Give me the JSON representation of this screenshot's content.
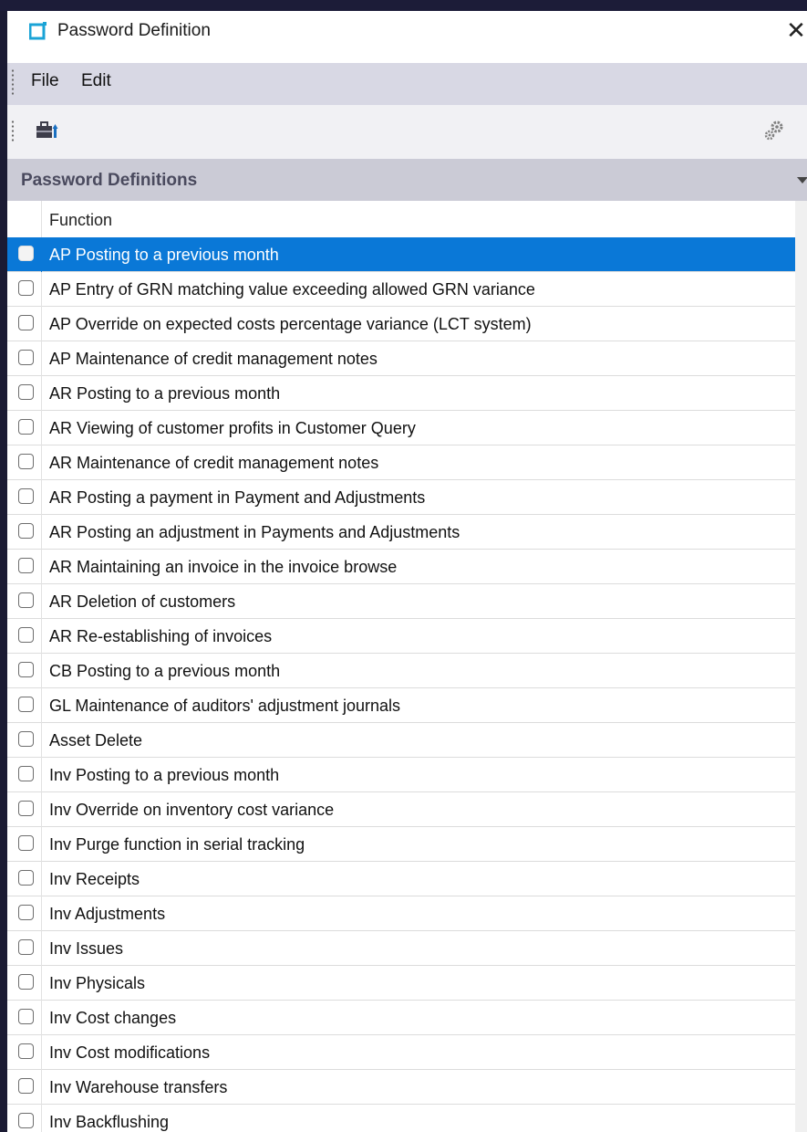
{
  "window": {
    "title": "Password Definition",
    "close_glyph": "✕"
  },
  "menu": {
    "items": [
      "File",
      "Edit"
    ]
  },
  "toolbar": {
    "icons": [
      "toolbox-icon",
      "gear-icon"
    ]
  },
  "section": {
    "title": "Password Definitions"
  },
  "grid": {
    "column_header": "Function",
    "selected_index": 0,
    "rows": [
      "AP Posting to a previous month",
      "AP Entry of GRN matching value exceeding allowed GRN variance",
      "AP Override on expected costs percentage variance (LCT system)",
      "AP Maintenance of credit management notes",
      "AR Posting to a previous month",
      "AR Viewing of customer profits in Customer Query",
      "AR Maintenance of credit management notes",
      "AR Posting a payment in Payment and Adjustments",
      "AR Posting an adjustment in Payments and Adjustments",
      "AR Maintaining an invoice in the invoice browse",
      "AR Deletion of customers",
      "AR Re-establishing of invoices",
      "CB Posting to a previous month",
      "GL Maintenance of auditors' adjustment journals",
      "Asset Delete",
      "Inv Posting to a previous month",
      "Inv Override on inventory cost variance",
      "Inv Purge function in serial tracking",
      "Inv Receipts",
      "Inv Adjustments",
      "Inv Issues",
      "Inv Physicals",
      "Inv Cost changes",
      "Inv Cost modifications",
      "Inv Warehouse transfers",
      "Inv Backflushing"
    ]
  },
  "colors": {
    "selection": "#0a78d7",
    "menubar": "#d8d8e4",
    "section_header": "#cbcbd6",
    "app_icon": "#1aa3d6"
  }
}
